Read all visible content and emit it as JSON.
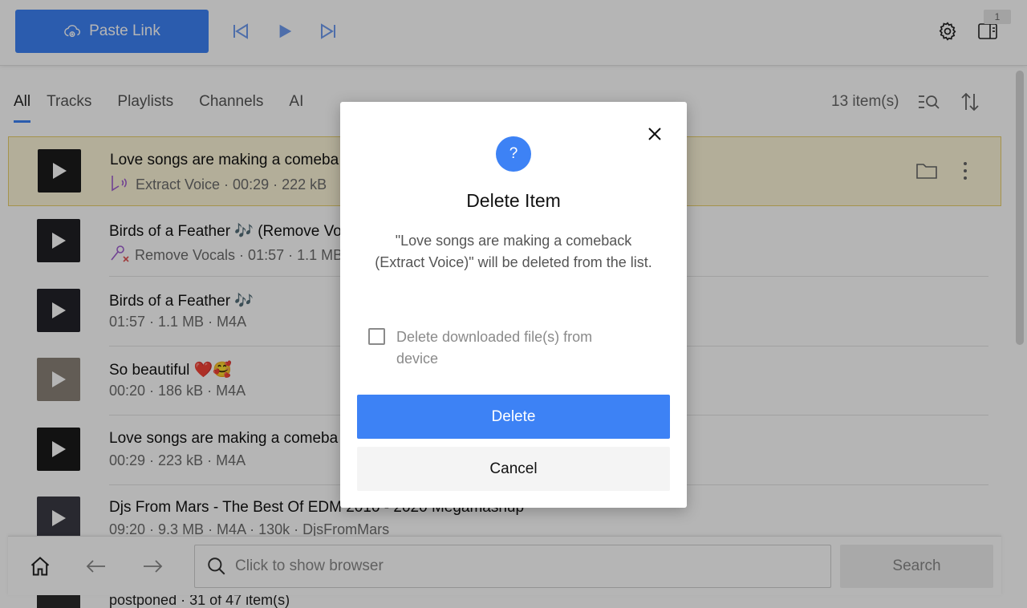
{
  "toolbar": {
    "paste_label": "Paste Link",
    "badge_count": "1",
    "icons": [
      "cloud-link-icon",
      "skip-previous-icon",
      "play-icon",
      "skip-next-icon",
      "gear-icon",
      "sidebar-panel-icon"
    ]
  },
  "tabs": [
    {
      "label": "All",
      "active": true
    },
    {
      "label": "Tracks",
      "active": false
    },
    {
      "label": "Playlists",
      "active": false
    },
    {
      "label": "Channels",
      "active": false
    },
    {
      "label": "AI",
      "active": false
    }
  ],
  "list_header": {
    "count": "13 item(s)"
  },
  "items": [
    {
      "title": "Love songs are making a comeba",
      "meta": "Extract Voice · 00:29 · 222 kB",
      "meta_icon": "extract-voice-icon",
      "highlighted": true
    },
    {
      "title": "Birds of a Feather 🎶 (Remove Vo",
      "meta": "Remove Vocals · 01:57 · 1.1 MB",
      "meta_icon": "remove-vocals-icon",
      "highlighted": false
    },
    {
      "title": "Birds of a Feather 🎶",
      "meta": "01:57 · 1.1 MB · M4A",
      "highlighted": false
    },
    {
      "title": "So beautiful ❤️🥰",
      "meta": "00:20 · 186 kB · M4A",
      "highlighted": false
    },
    {
      "title": "Love songs are making a comeba",
      "meta": "00:29 · 223 kB · M4A",
      "highlighted": false
    },
    {
      "title": "Djs From Mars - The Best Of EDM 2010 - 2020 Megamashup",
      "meta": "09:20 · 9.3 MB · M4A · 130k · DjsFromMars",
      "highlighted": false
    }
  ],
  "peek_item": {
    "meta": "postponed · 31 of 47 item(s)"
  },
  "bottombar": {
    "search_placeholder": "Click to show browser",
    "search_button": "Search"
  },
  "dialog": {
    "icon": "?",
    "title": "Delete Item",
    "message": "\"Love songs are making a comeback (Extract Voice)\" will be deleted from the list.",
    "checkbox_label": "Delete downloaded file(s) from device",
    "checkbox_checked": false,
    "delete_label": "Delete",
    "cancel_label": "Cancel"
  },
  "colors": {
    "accent": "#3d82f5",
    "highlight_bg": "#fdf6d8",
    "highlight_border": "#e9cf6c"
  }
}
